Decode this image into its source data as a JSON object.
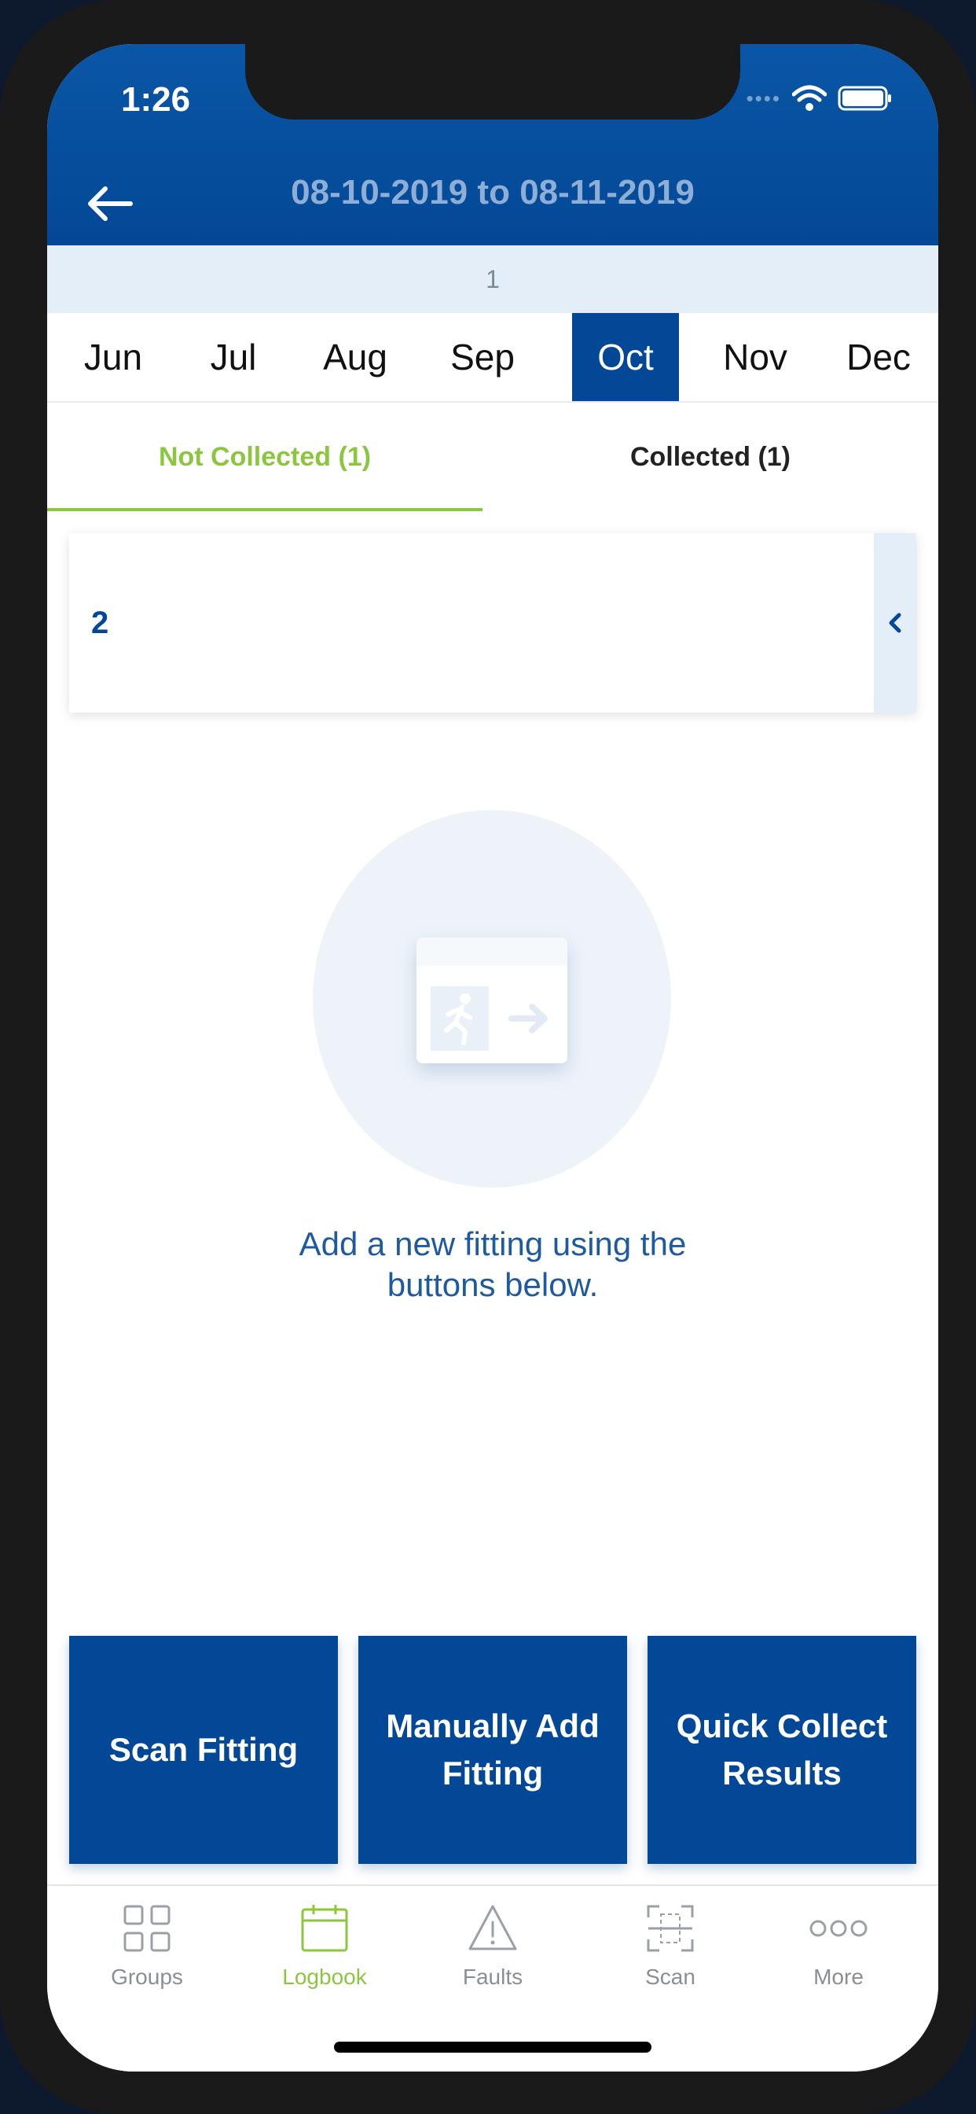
{
  "status": {
    "time": "1:26"
  },
  "header": {
    "title": "08-10-2019 to 08-11-2019"
  },
  "page_indicator": "1",
  "months": [
    {
      "label": "Jun",
      "selected": false
    },
    {
      "label": "Jul",
      "selected": false
    },
    {
      "label": "Aug",
      "selected": false
    },
    {
      "label": "Sep",
      "selected": false
    },
    {
      "label": "Oct",
      "selected": true
    },
    {
      "label": "Nov",
      "selected": false
    },
    {
      "label": "Dec",
      "selected": false
    }
  ],
  "tabs": {
    "not_collected": "Not Collected (1)",
    "collected": "Collected (1)"
  },
  "group_card": {
    "number": "2",
    "toggle_icon": "chevron-left-icon"
  },
  "empty_state": {
    "icon": "exit-sign-icon",
    "message": "Add a new fitting using the buttons below."
  },
  "actions": {
    "scan_fitting": "Scan Fitting",
    "manually_add": "Manually Add Fitting",
    "quick_collect": "Quick Collect Results"
  },
  "tabbar": [
    {
      "label": "Groups",
      "icon": "grid-icon",
      "active": false
    },
    {
      "label": "Logbook",
      "icon": "calendar-icon",
      "active": true
    },
    {
      "label": "Faults",
      "icon": "warning-triangle-icon",
      "active": false
    },
    {
      "label": "Scan",
      "icon": "scan-frame-icon",
      "active": false
    },
    {
      "label": "More",
      "icon": "more-dots-icon",
      "active": false
    }
  ],
  "colors": {
    "primary": "#034896",
    "accent_green": "#8cc63f",
    "page_bar": "#e3eef8"
  }
}
